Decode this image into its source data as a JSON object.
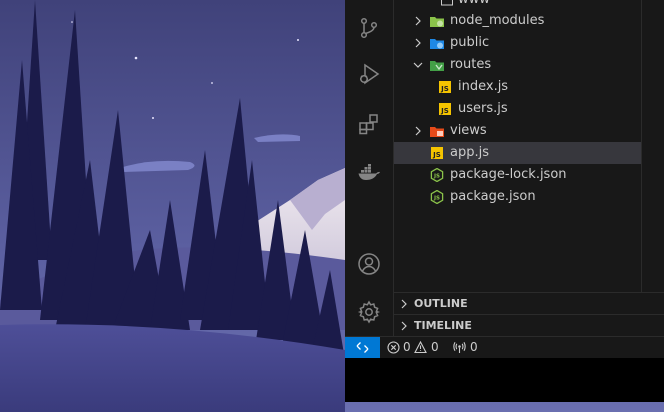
{
  "explorer": {
    "items": [
      {
        "label": "www",
        "type": "folder",
        "icon": "folder-icon"
      },
      {
        "label": "node_modules",
        "type": "folder",
        "icon": "node-folder-icon",
        "icon_color": "#8bc34a"
      },
      {
        "label": "public",
        "type": "folder",
        "icon": "public-folder-icon",
        "icon_color": "#1e88e5"
      },
      {
        "label": "routes",
        "type": "folder",
        "icon": "routes-folder-icon",
        "icon_color": "#43a047",
        "expanded": true
      },
      {
        "label": "index.js",
        "type": "file",
        "icon": "javascript-file-icon",
        "icon_color": "#f5c400"
      },
      {
        "label": "users.js",
        "type": "file",
        "icon": "javascript-file-icon",
        "icon_color": "#f5c400"
      },
      {
        "label": "views",
        "type": "folder",
        "icon": "views-folder-icon",
        "icon_color": "#e64a19"
      },
      {
        "label": "app.js",
        "type": "file",
        "icon": "javascript-file-icon",
        "icon_color": "#f5c400",
        "selected": true
      },
      {
        "label": "package-lock.json",
        "type": "file",
        "icon": "node-json-file-icon",
        "icon_color": "#8bc34a"
      },
      {
        "label": "package.json",
        "type": "file",
        "icon": "node-json-file-icon",
        "icon_color": "#8bc34a"
      }
    ],
    "sections": [
      {
        "label": "OUTLINE"
      },
      {
        "label": "TIMELINE"
      }
    ]
  },
  "activity_bar": {
    "items": [
      "source-control-icon",
      "run-debug-icon",
      "extensions-icon",
      "docker-icon",
      "accounts-icon",
      "settings-gear-icon"
    ]
  },
  "status_bar": {
    "errors": "0",
    "warnings": "0",
    "ports": "0",
    "accent": "#0078d4"
  },
  "colors": {
    "sidebar_bg": "#181818",
    "selection_bg": "#37373d",
    "text": "#cccccc"
  }
}
